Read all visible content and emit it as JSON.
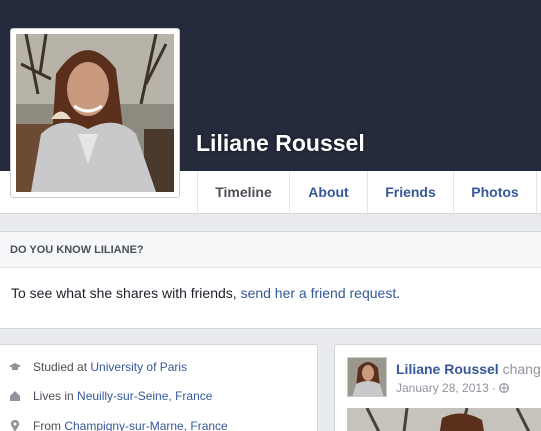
{
  "profile": {
    "name": "Liliane Roussel"
  },
  "tabs": [
    {
      "label": "Timeline",
      "active": true
    },
    {
      "label": "About"
    },
    {
      "label": "Friends"
    },
    {
      "label": "Photos"
    }
  ],
  "do_you_know": {
    "header": "DO YOU KNOW LILIANE?",
    "text": "To see what she shares with friends, ",
    "link": "send her a friend request",
    "suffix": "."
  },
  "intro": [
    {
      "icon": "graduation-cap-icon",
      "prefix": "Studied at ",
      "link": "University of Paris"
    },
    {
      "icon": "house-icon",
      "prefix": "Lives in ",
      "link": "Neuilly-sur-Seine, France"
    },
    {
      "icon": "location-pin-icon",
      "prefix": "From ",
      "link": "Champigny-sur-Marne, France"
    }
  ],
  "post": {
    "author": "Liliane Roussel",
    "action": " chang",
    "date": "January 28, 2013 · ",
    "privacy_icon": "globe-icon"
  },
  "colors": {
    "cover": "#252a3c",
    "link": "#365899",
    "page_bg": "#e9ebee"
  }
}
